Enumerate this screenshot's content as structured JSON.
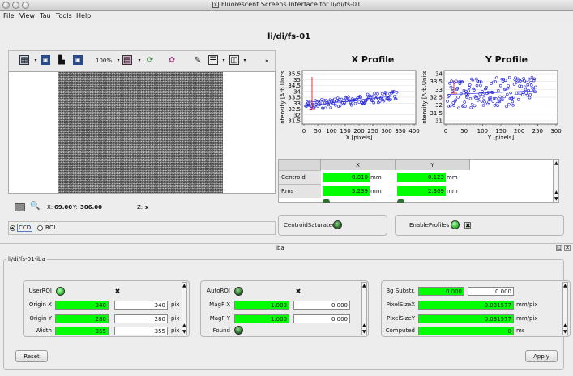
{
  "window": {
    "title": "Fluorescent Screens Interface for li/di/fs-01"
  },
  "menus": [
    "File",
    "View",
    "Tau",
    "Tools",
    "Help"
  ],
  "page_title": "li/di/fs-01",
  "toolbar": {
    "zoom": "100%",
    "more": "»"
  },
  "image_status": {
    "x_label": "X:",
    "x_value": "69.00",
    "y_label": "Y:",
    "y_value": "306.00",
    "z_label": "Z:",
    "z_value": "x"
  },
  "source": {
    "ccd": "CCD",
    "roi": "ROI"
  },
  "x_profile": {
    "title": "X Profile",
    "xlabel": "X [pixels]",
    "ylabel": "ntensity [Arb.Units",
    "yticks": [
      "35.5",
      "35",
      "34.5",
      "34",
      "33.5",
      "33",
      "32.5",
      "32",
      "31.5"
    ],
    "xticks": [
      "0",
      "50",
      "100",
      "150",
      "200",
      "250",
      "300",
      "350",
      "400"
    ]
  },
  "y_profile": {
    "title": "Y Profile",
    "xlabel": "Y [pixels]",
    "ylabel": "ntensity [Arb.Units",
    "yticks": [
      "34",
      "33.5",
      "33",
      "32.5",
      "32",
      "31.5",
      "31"
    ],
    "xticks": [
      "0",
      "50",
      "100",
      "150",
      "200",
      "250",
      "300"
    ]
  },
  "table": {
    "headers": [
      "",
      "X",
      "Y"
    ],
    "rows": [
      {
        "label": "Centroid",
        "x": "0.010",
        "x_unit": "mm",
        "y": "0.123",
        "y_unit": "mm"
      },
      {
        "label": "Rms",
        "x": "3.239",
        "x_unit": "mm",
        "y": "2.369",
        "y_unit": "mm"
      }
    ]
  },
  "centroid_saturated": "CentroidSaturated",
  "enable_profiles": "EnableProfiles",
  "iba_title": "iba",
  "iba_group": "li/di/fs-01-iba",
  "user_roi": {
    "label": "UserROI",
    "rows": [
      {
        "label": "Origin X",
        "value": "340",
        "set": "340",
        "unit": "pix"
      },
      {
        "label": "Origin Y",
        "value": "280",
        "set": "280",
        "unit": "pix"
      },
      {
        "label": "Width",
        "value": "355",
        "set": "355",
        "unit": "pix"
      }
    ]
  },
  "auto_roi": {
    "label": "AutoROI",
    "rows": [
      {
        "label": "MagF X",
        "value": "1.000",
        "set": "0.000"
      },
      {
        "label": "MagF Y",
        "value": "1.000",
        "set": "0.000"
      }
    ],
    "found": "Found"
  },
  "bg": {
    "rows": [
      {
        "label": "Bg Substr.",
        "value": "0.000",
        "set": "0.000",
        "unit": ""
      },
      {
        "label": "PixelSizeX",
        "value": "0.031577",
        "unit": "mm/pix"
      },
      {
        "label": "PixelSizeY",
        "value": "0.031577",
        "unit": "mm/pix"
      },
      {
        "label": "Computed",
        "value": "0",
        "unit": "ms"
      }
    ]
  },
  "buttons": {
    "reset": "Reset",
    "apply": "Apply"
  },
  "colors": {
    "led_green": "#2f8f2f",
    "value_green": "#00ff00",
    "plot_points": "#2222dd",
    "marker_red": "#dd0000"
  }
}
